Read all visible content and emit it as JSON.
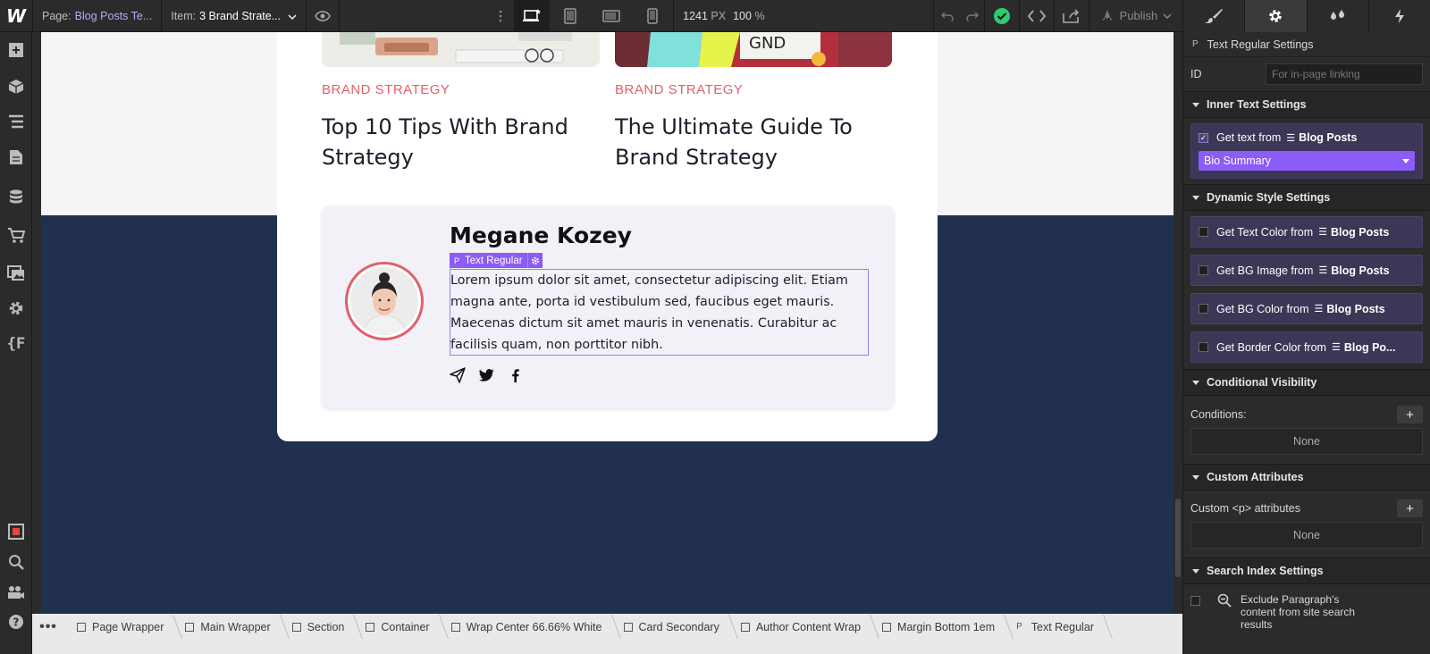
{
  "topbar": {
    "page_label": "Page:",
    "page_value": "Blog Posts Te...",
    "item_label": "Item:",
    "item_value": "3 Brand Strate...",
    "width_value": "1241",
    "width_unit": "PX",
    "zoom_value": "100",
    "zoom_unit": "%",
    "publish_label": "Publish"
  },
  "canvas": {
    "posts": [
      {
        "category": "BRAND STRATEGY",
        "title": "Top 10 Tips With Brand Strategy"
      },
      {
        "category": "BRAND STRATEGY",
        "title": "The Ultimate Guide To Brand Strategy"
      }
    ],
    "author": {
      "name": "Megane Kozey",
      "selection_tag": "Text Regular",
      "bio": "Lorem ipsum dolor sit amet, consectetur adipiscing elit. Etiam magna ante, porta id vestibulum sed, faucibus eget mauris. Maecenas dictum sit amet mauris in venenatis. Curabitur ac facilisis quam, non porttitor nibh."
    }
  },
  "breadcrumb": [
    "Page Wrapper",
    "Main Wrapper",
    "Section",
    "Container",
    "Wrap Center 66.66% White",
    "Card Secondary",
    "Author Content Wrap",
    "Margin Bottom 1em",
    "Text Regular"
  ],
  "panel": {
    "title": "Text Regular Settings",
    "id_label": "ID",
    "id_placeholder": "For in-page linking",
    "inner_text": {
      "heading": "Inner Text Settings",
      "get_text_label": "Get text from",
      "source": "Blog Posts",
      "selected_field": "Bio Summary"
    },
    "dynamic_style": {
      "heading": "Dynamic Style Settings",
      "options": [
        {
          "label": "Get Text Color from",
          "source": "Blog Posts"
        },
        {
          "label": "Get BG Image from",
          "source": "Blog Posts"
        },
        {
          "label": "Get BG Color from",
          "source": "Blog Posts"
        },
        {
          "label": "Get Border Color from",
          "source": "Blog Po..."
        }
      ]
    },
    "conditional_visibility": {
      "heading": "Conditional Visibility",
      "conditions_label": "Conditions:",
      "none_label": "None"
    },
    "custom_attributes": {
      "heading": "Custom Attributes",
      "label": "Custom <p> attributes",
      "none_label": "None"
    },
    "search_index": {
      "heading": "Search Index Settings",
      "exclude_label": "Exclude Paragraph's content from site search results"
    }
  },
  "colors": {
    "accent_purple": "#8b5cf6",
    "brand_red": "#e25f6a",
    "navy": "#21304f",
    "success_green": "#2ecc71"
  }
}
